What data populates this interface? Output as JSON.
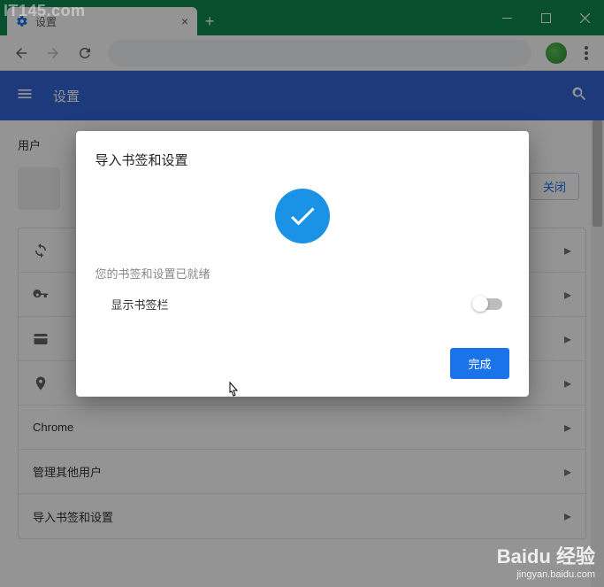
{
  "window": {
    "tab_title": "设置",
    "close_chip": "关闭"
  },
  "appbar": {
    "title": "设置"
  },
  "section": {
    "user_title": "用户"
  },
  "rows": {
    "r0": "",
    "r1": "",
    "r2": "",
    "r3": "",
    "r4": "Chrome",
    "r5": "管理其他用户",
    "r6": "导入书签和设置"
  },
  "dialog": {
    "title": "导入书签和设置",
    "status": "您的书签和设置已就绪",
    "option_label": "显示书签栏",
    "done": "完成"
  },
  "watermark": {
    "tl": "IT145.com",
    "br_main": "Baidu 经验",
    "br_sub": "jingyan.baidu.com"
  }
}
